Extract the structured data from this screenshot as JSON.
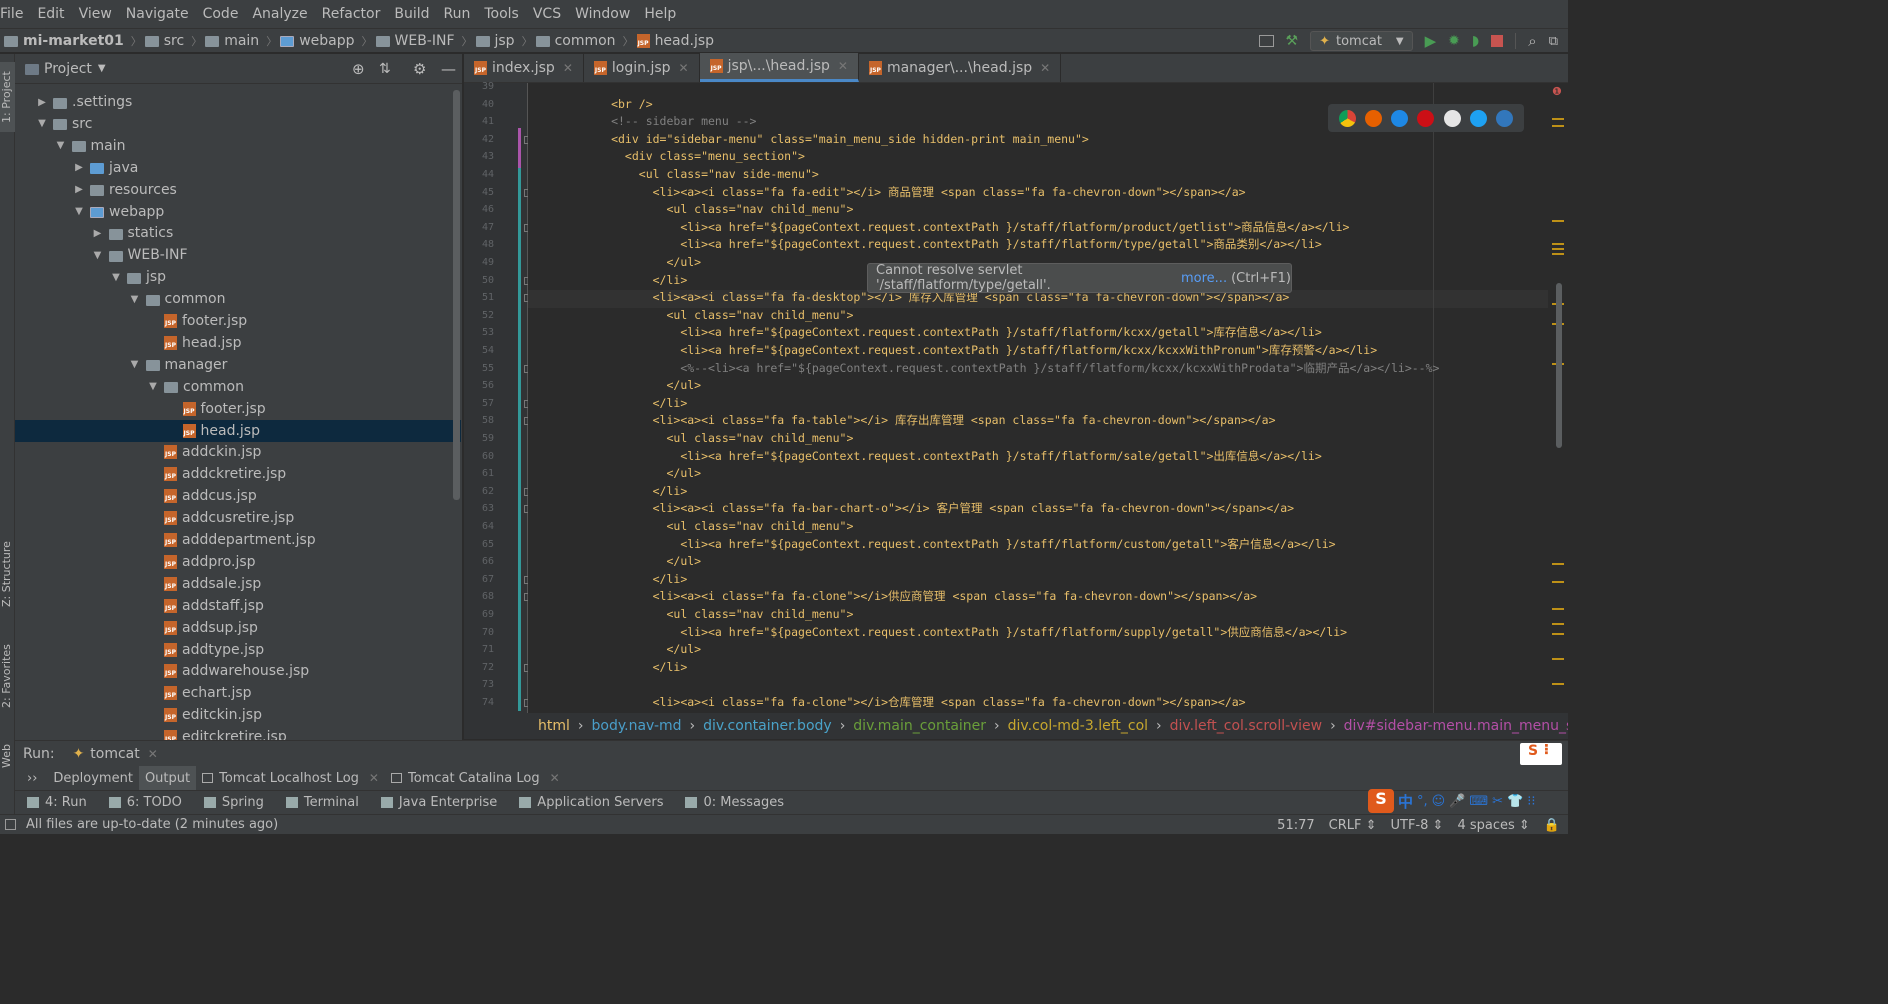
{
  "menu": [
    "File",
    "Edit",
    "View",
    "Navigate",
    "Code",
    "Analyze",
    "Refactor",
    "Build",
    "Run",
    "Tools",
    "VCS",
    "Window",
    "Help"
  ],
  "nav": {
    "project": "mi-market01",
    "crumbs": [
      "src",
      "main",
      "webapp",
      "WEB-INF",
      "jsp",
      "common"
    ],
    "file": "head.jsp",
    "run_config": "tomcat"
  },
  "side_tabs": {
    "project": "1: Project",
    "structure": "Z: Structure",
    "favorites": "2: Favorites",
    "web": "Web"
  },
  "project": {
    "title": "Project",
    "tree": [
      {
        "label": ".settings",
        "depth": 1,
        "arrow": "right",
        "icon": "folder"
      },
      {
        "label": "src",
        "depth": 1,
        "arrow": "down",
        "icon": "folder"
      },
      {
        "label": "main",
        "depth": 2,
        "arrow": "down",
        "icon": "folder"
      },
      {
        "label": "java",
        "depth": 3,
        "arrow": "right",
        "icon": "folder-blue"
      },
      {
        "label": "resources",
        "depth": 3,
        "arrow": "right",
        "icon": "folder-res"
      },
      {
        "label": "webapp",
        "depth": 3,
        "arrow": "down",
        "icon": "folder-web"
      },
      {
        "label": "statics",
        "depth": 4,
        "arrow": "right",
        "icon": "folder"
      },
      {
        "label": "WEB-INF",
        "depth": 4,
        "arrow": "down",
        "icon": "folder"
      },
      {
        "label": "jsp",
        "depth": 5,
        "arrow": "down",
        "icon": "folder"
      },
      {
        "label": "common",
        "depth": 6,
        "arrow": "down",
        "icon": "folder"
      },
      {
        "label": "footer.jsp",
        "depth": 7,
        "arrow": "",
        "icon": "jsp"
      },
      {
        "label": "head.jsp",
        "depth": 7,
        "arrow": "",
        "icon": "jsp"
      },
      {
        "label": "manager",
        "depth": 6,
        "arrow": "down",
        "icon": "folder"
      },
      {
        "label": "common",
        "depth": 7,
        "arrow": "down",
        "icon": "folder"
      },
      {
        "label": "footer.jsp",
        "depth": 8,
        "arrow": "",
        "icon": "jsp"
      },
      {
        "label": "head.jsp",
        "depth": 8,
        "arrow": "",
        "icon": "jsp",
        "selected": true
      },
      {
        "label": "addckin.jsp",
        "depth": 7,
        "arrow": "",
        "icon": "jsp"
      },
      {
        "label": "addckretire.jsp",
        "depth": 7,
        "arrow": "",
        "icon": "jsp"
      },
      {
        "label": "addcus.jsp",
        "depth": 7,
        "arrow": "",
        "icon": "jsp"
      },
      {
        "label": "addcusretire.jsp",
        "depth": 7,
        "arrow": "",
        "icon": "jsp"
      },
      {
        "label": "adddepartment.jsp",
        "depth": 7,
        "arrow": "",
        "icon": "jsp"
      },
      {
        "label": "addpro.jsp",
        "depth": 7,
        "arrow": "",
        "icon": "jsp"
      },
      {
        "label": "addsale.jsp",
        "depth": 7,
        "arrow": "",
        "icon": "jsp"
      },
      {
        "label": "addstaff.jsp",
        "depth": 7,
        "arrow": "",
        "icon": "jsp"
      },
      {
        "label": "addsup.jsp",
        "depth": 7,
        "arrow": "",
        "icon": "jsp"
      },
      {
        "label": "addtype.jsp",
        "depth": 7,
        "arrow": "",
        "icon": "jsp"
      },
      {
        "label": "addwarehouse.jsp",
        "depth": 7,
        "arrow": "",
        "icon": "jsp"
      },
      {
        "label": "echart.jsp",
        "depth": 7,
        "arrow": "",
        "icon": "jsp"
      },
      {
        "label": "editckin.jsp",
        "depth": 7,
        "arrow": "",
        "icon": "jsp"
      },
      {
        "label": "editckretire.jsp",
        "depth": 7,
        "arrow": "",
        "icon": "jsp"
      }
    ]
  },
  "tabs": [
    {
      "label": "index.jsp"
    },
    {
      "label": "login.jsp"
    },
    {
      "label": "jsp\\...\\head.jsp",
      "active": true
    },
    {
      "label": "manager\\...\\head.jsp"
    }
  ],
  "code": [
    {
      "n": "39",
      "t": ""
    },
    {
      "n": "40",
      "t": "            <br />"
    },
    {
      "n": "41",
      "t": "            <!-- sidebar menu -->"
    },
    {
      "n": "42",
      "t": "            <div id=\"sidebar-menu\" class=\"main_menu_side hidden-print main_menu\">"
    },
    {
      "n": "43",
      "t": "              <div class=\"menu_section\">"
    },
    {
      "n": "44",
      "t": "                <ul class=\"nav side-menu\">"
    },
    {
      "n": "45",
      "t": "                  <li><a><i class=\"fa fa-edit\"></i> 商品管理 <span class=\"fa fa-chevron-down\"></span></a>"
    },
    {
      "n": "46",
      "t": "                    <ul class=\"nav child_menu\">"
    },
    {
      "n": "47",
      "t": "                      <li><a href=\"${pageContext.request.contextPath }/staff/flatform/product/getlist\">商品信息</a></li>"
    },
    {
      "n": "48",
      "t": "                      <li><a href=\"${pageContext.request.contextPath }/staff/flatform/type/getall\">商品类别</a></li>"
    },
    {
      "n": "49",
      "t": "                    </ul>"
    },
    {
      "n": "50",
      "t": "                  </li>"
    },
    {
      "n": "51",
      "t": "                  <li><a><i class=\"fa fa-desktop\"></i> 库存入库管理 <span class=\"fa fa-chevron-down\"></span></a>"
    },
    {
      "n": "52",
      "t": "                    <ul class=\"nav child_menu\">"
    },
    {
      "n": "53",
      "t": "                      <li><a href=\"${pageContext.request.contextPath }/staff/flatform/kcxx/getall\">库存信息</a></li>"
    },
    {
      "n": "54",
      "t": "                      <li><a href=\"${pageContext.request.contextPath }/staff/flatform/kcxx/kcxxWithPronum\">库存预警</a></li>"
    },
    {
      "n": "55",
      "t": "                      <%--<li><a href=\"${pageContext.request.contextPath }/staff/flatform/kcxx/kcxxWithProdata\">临期产品</a></li>--%>"
    },
    {
      "n": "56",
      "t": "                    </ul>"
    },
    {
      "n": "57",
      "t": "                  </li>"
    },
    {
      "n": "58",
      "t": "                  <li><a><i class=\"fa fa-table\"></i> 库存出库管理 <span class=\"fa fa-chevron-down\"></span></a>"
    },
    {
      "n": "59",
      "t": "                    <ul class=\"nav child_menu\">"
    },
    {
      "n": "60",
      "t": "                      <li><a href=\"${pageContext.request.contextPath }/staff/flatform/sale/getall\">出库信息</a></li>"
    },
    {
      "n": "61",
      "t": "                    </ul>"
    },
    {
      "n": "62",
      "t": "                  </li>"
    },
    {
      "n": "63",
      "t": "                  <li><a><i class=\"fa fa-bar-chart-o\"></i> 客户管理 <span class=\"fa fa-chevron-down\"></span></a>"
    },
    {
      "n": "64",
      "t": "                    <ul class=\"nav child_menu\">"
    },
    {
      "n": "65",
      "t": "                      <li><a href=\"${pageContext.request.contextPath }/staff/flatform/custom/getall\">客户信息</a></li>"
    },
    {
      "n": "66",
      "t": "                    </ul>"
    },
    {
      "n": "67",
      "t": "                  </li>"
    },
    {
      "n": "68",
      "t": "                  <li><a><i class=\"fa fa-clone\"></i>供应商管理 <span class=\"fa fa-chevron-down\"></span></a>"
    },
    {
      "n": "69",
      "t": "                    <ul class=\"nav child_menu\">"
    },
    {
      "n": "70",
      "t": "                      <li><a href=\"${pageContext.request.contextPath }/staff/flatform/supply/getall\">供应商信息</a></li>"
    },
    {
      "n": "71",
      "t": "                    </ul>"
    },
    {
      "n": "72",
      "t": "                  </li>"
    },
    {
      "n": "73",
      "t": ""
    },
    {
      "n": "74",
      "t": "                  <li><a><i class=\"fa fa-clone\"></i>仓库管理 <span class=\"fa fa-chevron-down\"></span></a>"
    }
  ],
  "tooltip": {
    "text": "Cannot resolve servlet '/staff/flatform/type/getall'.",
    "link": "more...",
    "shortcut": "(Ctrl+F1)"
  },
  "breadcrumb": [
    {
      "label": "html",
      "color": "#e8bf6a"
    },
    {
      "label": "body.nav-md",
      "color": "#4a9ec9"
    },
    {
      "label": "div.container.body",
      "color": "#4aa3c9"
    },
    {
      "label": "div.main_container",
      "color": "#6a9f3a"
    },
    {
      "label": "div.col-md-3.left_col",
      "color": "#c7a72e"
    },
    {
      "label": "div.left_col.scroll-view",
      "color": "#c25151"
    },
    {
      "label": "div#sidebar-menu.main_menu_side.hidden-pri",
      "color": "#b34fa6"
    }
  ],
  "run": {
    "label": "Run:",
    "config": "tomcat",
    "tabs": [
      "Deployment",
      "Output",
      "Tomcat Localhost Log",
      "Tomcat Catalina Log"
    ],
    "selected_tab": "Output"
  },
  "tools": [
    "4: Run",
    "6: TODO",
    "Spring",
    "Terminal",
    "Java Enterprise",
    "Application Servers",
    "0: Messages"
  ],
  "status": {
    "message": "All files are up-to-date (2 minutes ago)",
    "position": "51:77",
    "line_sep": "CRLF",
    "encoding": "UTF-8",
    "indent": "4 spaces"
  },
  "ime": {
    "chars": "中"
  }
}
